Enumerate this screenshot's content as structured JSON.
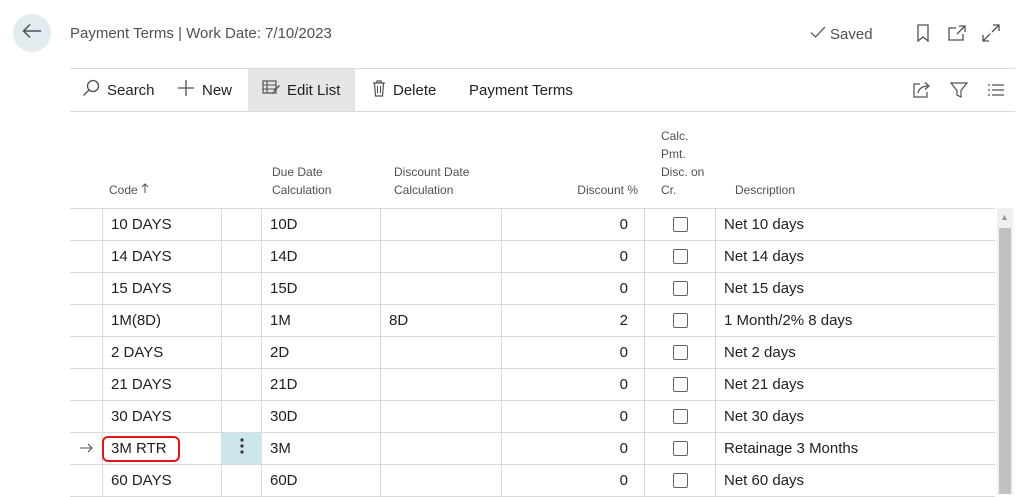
{
  "header": {
    "title": "Payment Terms | Work Date: 7/10/2023",
    "saved_label": "Saved"
  },
  "toolbar": {
    "search_label": "Search",
    "new_label": "New",
    "edit_list_label": "Edit List",
    "delete_label": "Delete",
    "payment_terms_label": "Payment Terms"
  },
  "columns": {
    "code": "Code",
    "due_date_line1": "Due Date",
    "due_date_line2": "Calculation",
    "discount_date_line1": "Discount Date",
    "discount_date_line2": "Calculation",
    "discount_pct": "Discount %",
    "calc_line1": "Calc.",
    "calc_line2": "Pmt.",
    "calc_line3": "Disc. on",
    "calc_line4": "Cr.",
    "description": "Description"
  },
  "rows": [
    {
      "code": "10 DAYS",
      "due_date": "10D",
      "discount_date": "",
      "discount": "0",
      "description": "Net 10 days"
    },
    {
      "code": "14 DAYS",
      "due_date": "14D",
      "discount_date": "",
      "discount": "0",
      "description": "Net 14 days"
    },
    {
      "code": "15 DAYS",
      "due_date": "15D",
      "discount_date": "",
      "discount": "0",
      "description": "Net 15 days"
    },
    {
      "code": "1M(8D)",
      "due_date": "1M",
      "discount_date": "8D",
      "discount": "2",
      "description": "1 Month/2% 8 days"
    },
    {
      "code": "2 DAYS",
      "due_date": "2D",
      "discount_date": "",
      "discount": "0",
      "description": "Net 2 days"
    },
    {
      "code": "21 DAYS",
      "due_date": "21D",
      "discount_date": "",
      "discount": "0",
      "description": "Net 21 days"
    },
    {
      "code": "30 DAYS",
      "due_date": "30D",
      "discount_date": "",
      "discount": "0",
      "description": "Net 30 days"
    },
    {
      "code": "3M RTR",
      "due_date": "3M",
      "discount_date": "",
      "discount": "0",
      "description": "Retainage 3 Months"
    },
    {
      "code": "60 DAYS",
      "due_date": "60D",
      "discount_date": "",
      "discount": "0",
      "description": "Net 60 days"
    }
  ],
  "selected_row_index": 7,
  "colors": {
    "accent": "#e1141b",
    "selected_cell": "#cde5ec",
    "back_button": "#e1ebf0"
  }
}
